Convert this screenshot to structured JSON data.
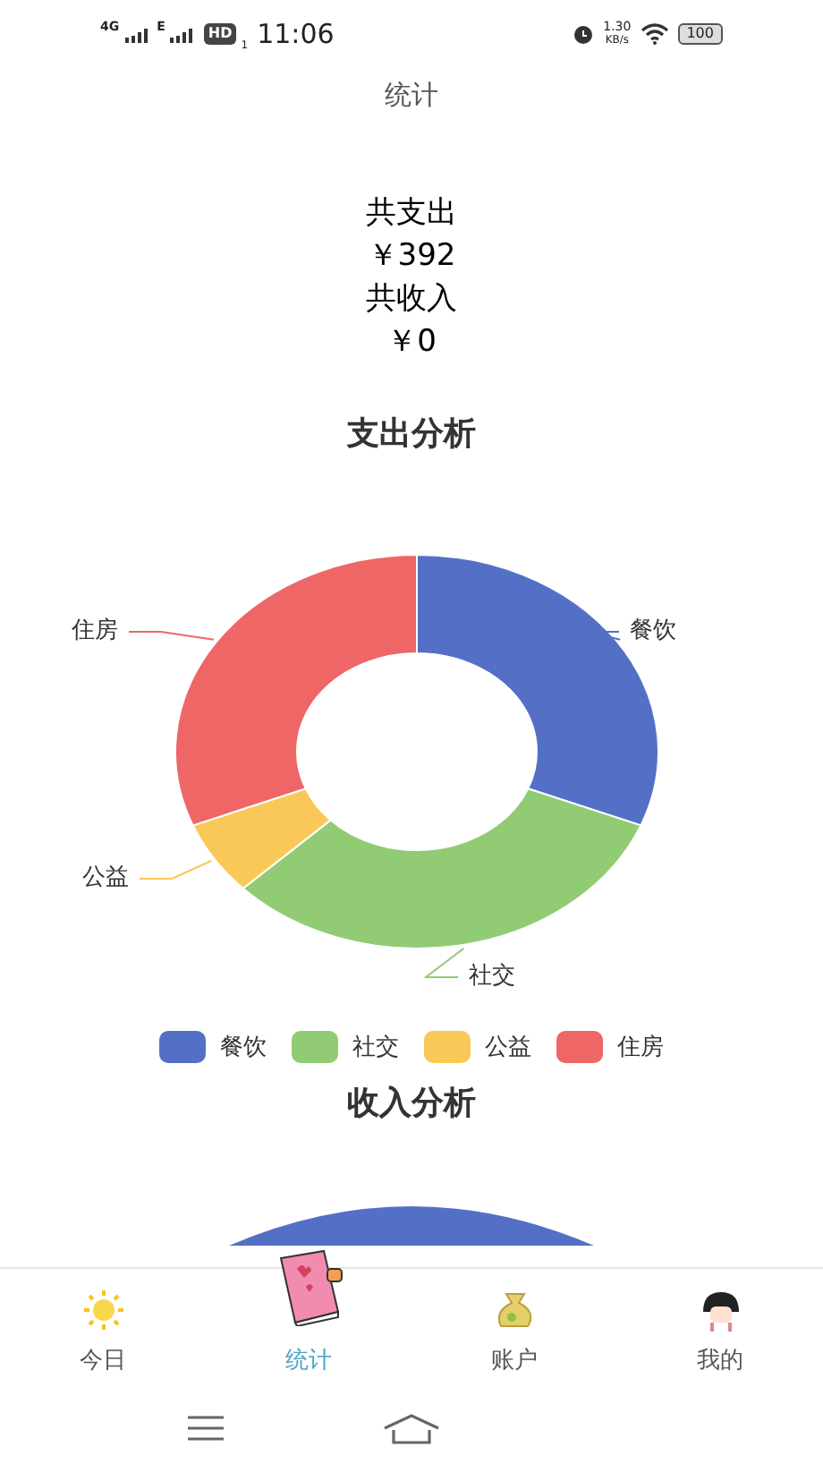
{
  "status_bar": {
    "network_1": "4G",
    "network_2": "E",
    "hd": "HD",
    "sim": "1",
    "time": "11:06",
    "speed_value": "1.30",
    "speed_unit": "KB/s",
    "battery": "100"
  },
  "header": {
    "title": "统计"
  },
  "summary": [
    "共支出",
    "￥392",
    "共收入",
    "￥0"
  ],
  "expense_section": {
    "title": "支出分析",
    "slices": [
      {
        "label": "餐饮",
        "color": "#5470c6"
      },
      {
        "label": "社交",
        "color": "#91cc75"
      },
      {
        "label": "公益",
        "color": "#fac858"
      },
      {
        "label": "住房",
        "color": "#ee6666"
      }
    ],
    "legend": [
      {
        "label": "餐饮",
        "color": "#5470c6"
      },
      {
        "label": "社交",
        "color": "#91cc75"
      },
      {
        "label": "公益",
        "color": "#fac858"
      },
      {
        "label": "住房",
        "color": "#ee6666"
      }
    ]
  },
  "income_section": {
    "title": "收入分析"
  },
  "tabs": [
    {
      "label": "今日",
      "selected": false
    },
    {
      "label": "统计",
      "selected": true
    },
    {
      "label": "账户",
      "selected": false
    },
    {
      "label": "我的",
      "selected": false
    }
  ]
}
